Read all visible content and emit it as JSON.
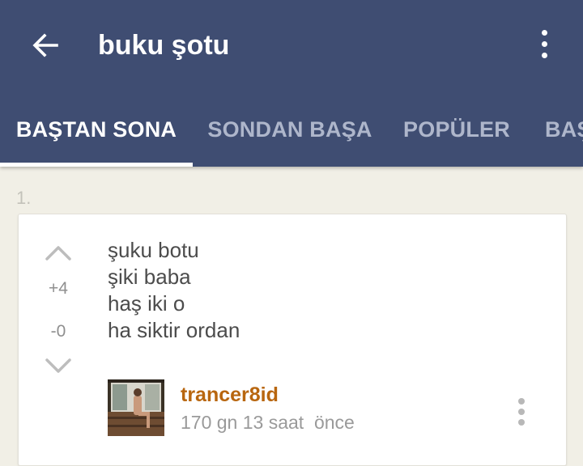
{
  "app_bar": {
    "title": "buku şotu",
    "back_icon": "arrow-left-icon",
    "menu_icon": "more-vertical-icon",
    "background_color": "#3f4d72"
  },
  "tabs": [
    {
      "label": "BAŞTAN SONA",
      "active": true
    },
    {
      "label": "SONDAN BAŞA",
      "active": false
    },
    {
      "label": "POPÜLER",
      "active": false
    },
    {
      "label": "BAŞ",
      "active": false
    }
  ],
  "entry": {
    "number": "1.",
    "upvote_icon": "chevron-up-icon",
    "downvote_icon": "chevron-down-icon",
    "plus_votes": "+4",
    "minus_votes": "-0",
    "lines": [
      "şuku botu",
      "şiki baba",
      "haş iki o",
      "ha siktir ordan"
    ],
    "author": "trancer8id",
    "time": "170 gn 13 saat  önce",
    "menu_icon": "more-vertical-icon",
    "author_color": "#b8660f"
  }
}
